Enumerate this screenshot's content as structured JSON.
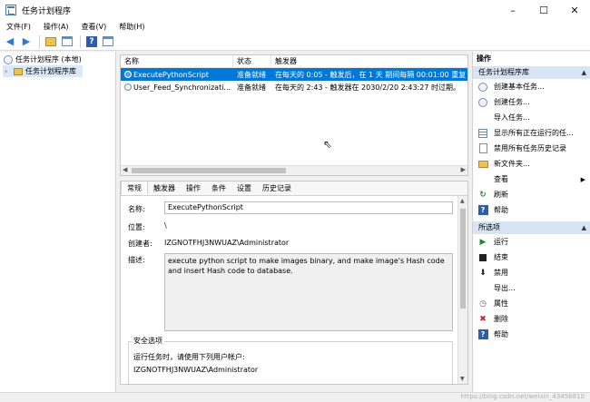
{
  "window": {
    "title": "任务计划程序",
    "controls": [
      "–",
      "☐",
      "✕"
    ]
  },
  "menubar": [
    "文件(F)",
    "操作(A)",
    "查看(V)",
    "帮助(H)"
  ],
  "tree": {
    "root": "任务计划程序 (本地)",
    "child": "任务计划程序库"
  },
  "tasklist": {
    "columns": [
      "名称",
      "状态",
      "触发器"
    ],
    "rows": [
      {
        "name": "ExecutePythonScript",
        "status": "准备就绪",
        "trigger": "在每天的 0:05 - 触发后，在 1 天 期间每隔 00:01:00 重复",
        "selected": true
      },
      {
        "name": "User_Feed_Synchronizati...",
        "status": "准备就绪",
        "trigger": "在每天的 2:43 - 触发器在 2030/2/20 2:43:27 时过期。",
        "selected": false
      }
    ]
  },
  "detail": {
    "tabs": [
      "常规",
      "触发器",
      "操作",
      "条件",
      "设置",
      "历史记录"
    ],
    "labels": {
      "name": "名称:",
      "location": "位置:",
      "author": "创建者:",
      "description": "描述:"
    },
    "values": {
      "name": "ExecutePythonScript",
      "location": "\\",
      "author": "IZGNOTFHJ3NWUAZ\\Administrator",
      "description": "execute python script to make images binary, and make image's Hash code and insert Hash code to database."
    },
    "security": {
      "title": "安全选项",
      "run_as_label": "运行任务时，请使用下列用户帐户:",
      "account": "IZGNOTFHJ3NWUAZ\\Administrator"
    }
  },
  "actions": {
    "header": "操作",
    "group1": "任务计划程序库",
    "group1_items": [
      {
        "label": "创建基本任务...",
        "icon": "clock-icon"
      },
      {
        "label": "创建任务...",
        "icon": "clock-icon"
      },
      {
        "label": "导入任务...",
        "icon": "blank"
      },
      {
        "label": "显示所有正在运行的任...",
        "icon": "list-icon"
      },
      {
        "label": "禁用所有任务历史记录",
        "icon": "doc-icon"
      },
      {
        "label": "新文件夹...",
        "icon": "folder-icon"
      },
      {
        "label": "查看",
        "icon": "blank",
        "submenu": true
      },
      {
        "label": "刷新",
        "icon": "refresh-icon"
      },
      {
        "label": "帮助",
        "icon": "help-icon"
      }
    ],
    "group2": "所选项",
    "group2_items": [
      {
        "label": "运行",
        "icon": "run-icon"
      },
      {
        "label": "结束",
        "icon": "stop-icon"
      },
      {
        "label": "禁用",
        "icon": "disable-icon"
      },
      {
        "label": "导出...",
        "icon": "blank"
      },
      {
        "label": "属性",
        "icon": "properties-icon"
      },
      {
        "label": "删除",
        "icon": "delete-icon"
      },
      {
        "label": "帮助",
        "icon": "help-icon"
      }
    ]
  },
  "statusbar": {
    "watermark": "https://blog.csdn.net/weixin_43456810"
  },
  "colors": {
    "selection": "#0078d7",
    "group_header": "#d6e4f4"
  }
}
